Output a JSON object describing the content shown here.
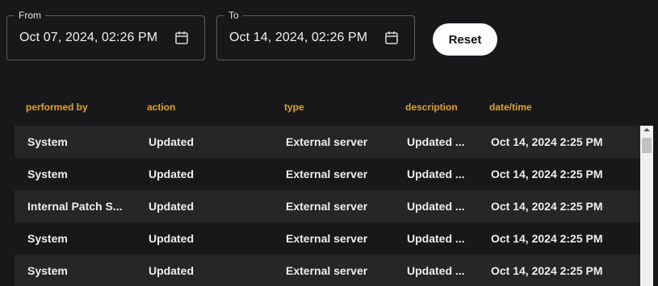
{
  "filters": {
    "from": {
      "label": "From",
      "value": "Oct 07, 2024, 02:26 PM",
      "icon": "calendar-icon"
    },
    "to": {
      "label": "To",
      "value": "Oct 14, 2024, 02:26 PM",
      "icon": "calendar-icon"
    },
    "reset_label": "Reset"
  },
  "table": {
    "columns": [
      "performed by",
      "action",
      "type",
      "description",
      "date/time"
    ],
    "rows": [
      [
        "System",
        "Updated",
        "External server",
        "Updated ...",
        "Oct 14, 2024 2:25 PM"
      ],
      [
        "System",
        "Updated",
        "External server",
        "Updated ...",
        "Oct 14, 2024 2:25 PM"
      ],
      [
        "Internal Patch S...",
        "Updated",
        "External server",
        "Updated ...",
        "Oct 14, 2024 2:25 PM"
      ],
      [
        "System",
        "Updated",
        "External server",
        "Updated ...",
        "Oct 14, 2024 2:25 PM"
      ],
      [
        "System",
        "Updated",
        "External server",
        "Updated ...",
        "Oct 14, 2024 2:25 PM"
      ]
    ]
  },
  "colors": {
    "background": "#18181a",
    "row_alt": "#262628",
    "header_accent": "#e0a22a",
    "button_bg": "#ffffff"
  }
}
